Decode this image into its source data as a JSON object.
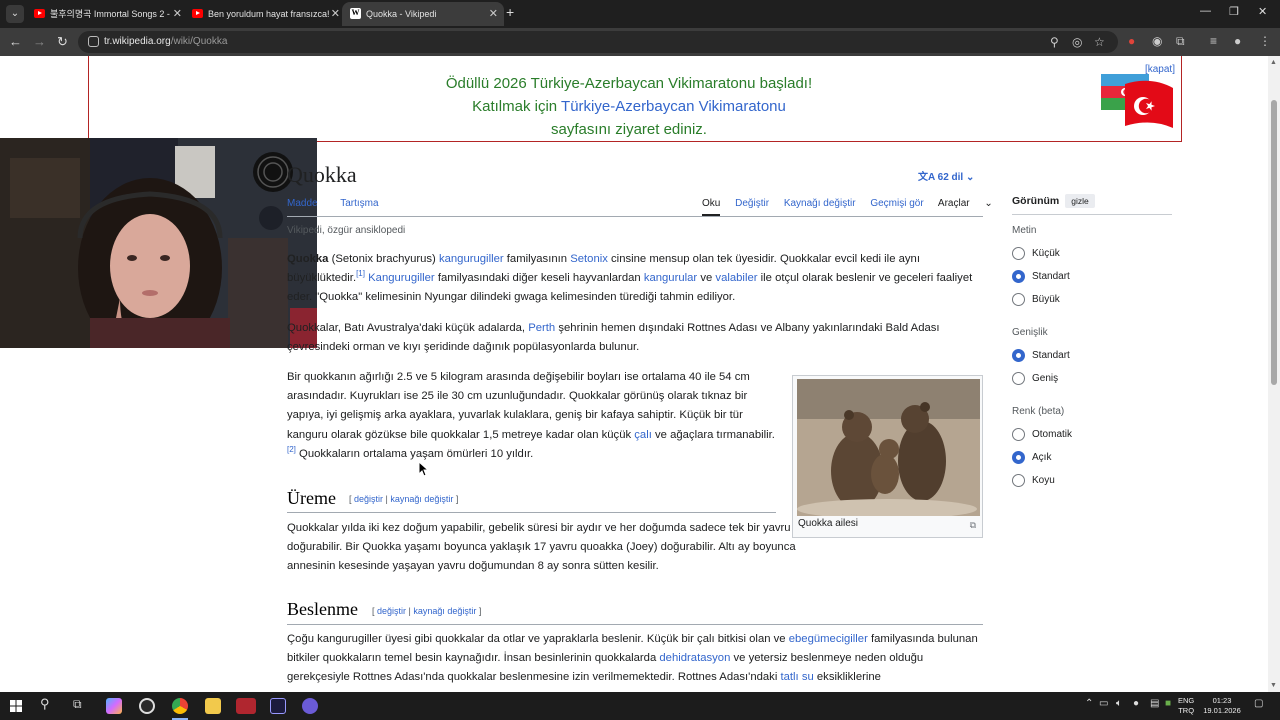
{
  "browser": {
    "tabs": [
      {
        "title": "불후의명곡 Immortal Songs 2 -",
        "icon": "youtube-icon",
        "active": false
      },
      {
        "title": "Ben yoruldum hayat fransızca!",
        "icon": "youtube-icon",
        "active": false
      },
      {
        "title": "Quokka - Vikipedi",
        "icon": "wikipedia-icon",
        "active": true
      }
    ],
    "url_host": "tr.wikipedia.org",
    "url_path": "/wiki/Quokka"
  },
  "banner": {
    "line1": "Ödüllü 2026 Türkiye-Azerbaycan Vikimaratonu başladı!",
    "line2_prefix": "Katılmak için ",
    "line2_link": "Türkiye-Azerbaycan Vikimaratonu",
    "line3": "sayfasını ziyaret ediniz.",
    "close": "[kapat]"
  },
  "article": {
    "title": "Quokka",
    "lang_count": "62 dil",
    "tab_article": "Madde",
    "tab_talk": "Tartışma",
    "tab_read": "Oku",
    "tab_edit": "Değiştir",
    "tab_edit_source": "Kaynağı değiştir",
    "tab_history": "Geçmişi gör",
    "tab_tools": "Araçlar",
    "tagline": "Vikipedi, özgür ansiklopedi",
    "p1": {
      "b": "Quokka",
      "t1": " (Setonix brachyurus) ",
      "l1": "kangurugiller",
      "t2": " familyasının ",
      "l2": "Setonix",
      "t3": " cinsine mensup olan tek üyesidir. Quokkalar evcil kedi ile aynı büyüklüktedir.",
      "ref": "[1]",
      "t4": " ",
      "l3": "Kangurugiller",
      "t5": " familyasındaki diğer keseli hayvanlardan ",
      "l4": "kangurular",
      "t6": " ve ",
      "l5": "valabiler",
      "t7": " ile otçul olarak beslenir ve geceleri faaliyet eder. \"Quokka\" kelimesinin Nyungar dilindeki gwaga kelimesinden türediği tahmin ediliyor."
    },
    "p2": {
      "t1": "Quokkalar, Batı Avustralya'daki küçük adalarda, ",
      "l1": "Perth",
      "t2": " şehrinin hemen dışındaki Rottnes Adası ve Albany yakınlarındaki Bald Adası çevresindeki orman ve kıyı şeridinde dağınık popülasyonlarda bulunur."
    },
    "p3": {
      "t1": "Bir quokkanın ağırlığı 2.5 ve 5 kilogram arasında değişebilir boyları ise ortalama 40 ile 54 cm arasındadır. Kuyrukları ise 25 ile 30 cm uzunluğundadır. Quokkalar görünüş olarak tıknaz bir yapıya, iyi gelişmiş arka ayaklara, yuvarlak kulaklara, geniş bir kafaya sahiptir. Küçük bir tür kanguru olarak gözükse bile quokkalar 1,5 metreye kadar olan küçük ",
      "l1": "çalı",
      "t2": " ve ağaçlara tırmanabilir.",
      "ref": "[2]",
      "t3": " Quokkaların ortalama yaşam ömürleri 10 yıldır."
    },
    "image_caption": "Quokka ailesi",
    "section1": {
      "heading": "Üreme",
      "edit_open": "[ ",
      "edit1": "değiştir",
      "edit_sep": " | ",
      "edit2": "kaynağı değiştir",
      "edit_close": " ]",
      "text": "Quokkalar yılda iki kez doğum yapabilir, gebelik süresi bir aydır ve her doğumda sadece tek bir yavru doğurabilir. Bir Quokka yaşamı boyunca yaklaşık 17 yavru quoakka (Joey) doğurabilir. Altı ay boyunca annesinin kesesinde yaşayan yavru doğumundan 8 ay sonra sütten kesilir."
    },
    "section2": {
      "heading": "Beslenme",
      "edit_open": "[ ",
      "edit1": "değiştir",
      "edit_sep": " | ",
      "edit2": "kaynağı değiştir",
      "edit_close": " ]",
      "t1": "Çoğu kangurugiller üyesi gibi quokkalar da otlar ve yapraklarla beslenir. Küçük bir çalı bitkisi olan ve ",
      "l1": "ebegümecigiller",
      "t2": " familyasında bulunan bitkiler quokkaların temel besin kaynağıdır. İnsan besinlerinin quokkalarda ",
      "l2": "dehidratasyon",
      "t3": " ve yetersiz beslenmeye neden olduğu gerekçesiyle Rottnes Adası'nda quokkalar beslenmesine izin verilmemektedir. Rottnes Adası'ndaki ",
      "l3": "tatlı su",
      "t4": " eksikliklerine"
    }
  },
  "sidebar": {
    "title": "Görünüm",
    "hide": "gizle",
    "text_label": "Metin",
    "text_options": [
      "Küçük",
      "Standart",
      "Büyük"
    ],
    "text_selected": "Standart",
    "width_label": "Genişlik",
    "width_options": [
      "Standart",
      "Geniş"
    ],
    "width_selected": "Standart",
    "color_label": "Renk (beta)",
    "color_options": [
      "Otomatik",
      "Açık",
      "Koyu"
    ],
    "color_selected": "Açık"
  },
  "taskbar": {
    "lang_top": "ENG",
    "lang_bottom": "TRQ",
    "time": "01:23",
    "date": "19.01.2026"
  },
  "colors": {
    "link": "#3366cc",
    "banner_green": "#2a7d2a",
    "selected_radio": "#3366cc"
  }
}
